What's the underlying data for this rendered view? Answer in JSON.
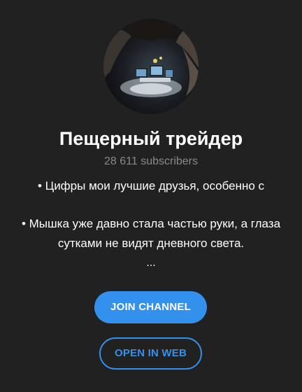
{
  "channel": {
    "avatar_icon": "channel-avatar-cave-trader",
    "title": "Пещерный трейдер",
    "subscribers": "28 611 subscribers",
    "description": [
      "• Цифры мои лучшие друзья, особенно с",
      "• Мышка уже давно стала частью руки, а глаза сутками не видят дневного света.",
      "..."
    ]
  },
  "actions": {
    "join_label": "JOIN CHANNEL",
    "open_web_label": "OPEN IN WEB"
  },
  "colors": {
    "background": "#212121",
    "accent": "#3390ec",
    "muted_text": "#8a8a8a"
  }
}
